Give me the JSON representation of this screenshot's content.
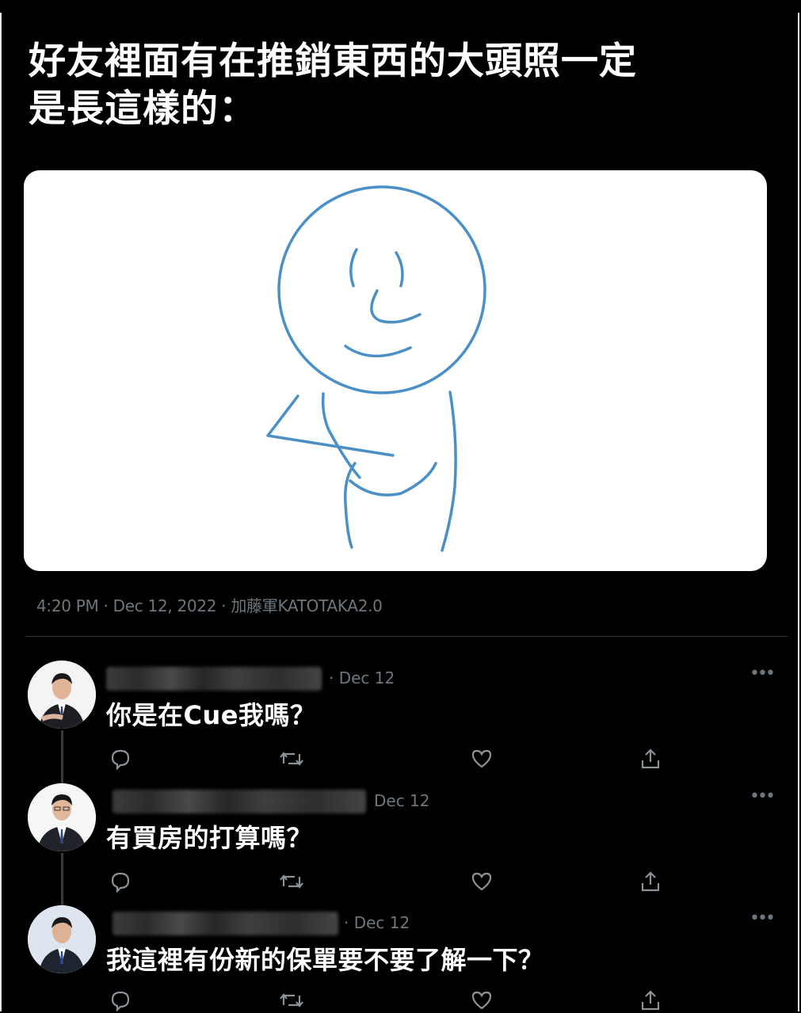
{
  "headline": {
    "line1": "好友裡面有在推銷東西的大頭照一定",
    "line2": "是長這樣的："
  },
  "tweet": {
    "timestamp": "4:20 PM · Dec 12, 2022 · 加藤軍KATOTAKA2.0",
    "image_subject": "stick figure with crossed arms and smirking face"
  },
  "replies": [
    {
      "date": "· Dec 12",
      "text": "你是在Cue我嗎？"
    },
    {
      "date": "Dec 12",
      "text": "有買房的打算嗎？"
    },
    {
      "date": "· Dec 12",
      "text": "我這裡有份新的保單要不要了解一下？"
    }
  ],
  "icons": {
    "reply": "reply-icon",
    "retweet": "retweet-icon",
    "like": "heart-icon",
    "share": "share-icon",
    "more": "more-icon"
  },
  "colors": {
    "background": "#000000",
    "text_primary": "#ffffff",
    "text_secondary": "#6e767d",
    "drawing_stroke": "#4a90c6"
  }
}
